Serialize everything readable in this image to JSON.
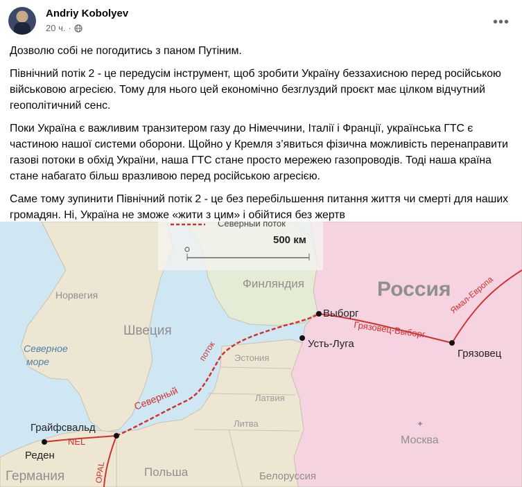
{
  "post": {
    "author": "Andriy Kobolyev",
    "time": "20 ч.",
    "separator": "·",
    "privacy_icon": "globe-icon",
    "more_icon": "more-dots-icon",
    "more_label": "•••",
    "paragraphs": [
      "Дозволю собі не погодитись з паном Путіним.",
      "Північний потік 2 - це передусім інструмент, щоб зробити Україну беззахисною перед російською військовою агресією. Тому для нього цей економічно безглуздий проєкт має цілком відчутний геополітичний сенс.",
      "Поки Україна є важливим транзитером газу до Німеччини, Італії і Франції, українська ГТС є частиною нашої системи оборони. Щойно у Кремля з’явиться фізична можливість перенаправити газові потоки в обхід України, наша ГТС стане просто мережею газопроводів. Тоді наша країна стане набагато більш вразливою перед російською агресією.",
      "Саме тому зупинити Північний потік 2 - це без перебільшення питання життя чи смерті для наших громадян. Ні, Україна не зможе «жити з цим» і обійтися без жертв"
    ]
  },
  "map": {
    "legend_title": "Северный поток",
    "scale_label": "500 км",
    "countries": {
      "russia": "Россия",
      "finland": "Финляндия",
      "norway": "Норвегия",
      "sweden": "Швеция",
      "estonia": "Эстония",
      "latvia": "Латвия",
      "lithuania": "Литва",
      "poland": "Польша",
      "germany": "Германия",
      "belarus": "Белоруссия"
    },
    "sea": {
      "north_sea_1": "Северное",
      "north_sea_2": "море"
    },
    "cities": {
      "vyborg": "Выборг",
      "ust_luga": "Усть-Луга",
      "gryazovets": "Грязовец",
      "greifswald": "Грайфсвальд",
      "reden": "Реден",
      "moscow": "Москва"
    },
    "pipelines": {
      "nord_stream_1": "Северный",
      "nord_stream_2": "поток",
      "gryazovets_vyborg": "Грязовец-Выборг",
      "yamal_europe": "Ямал-Европа",
      "nel": "NEL",
      "opal": "OPAL"
    },
    "colors": {
      "sea": "#cfe6f3",
      "land_west": "#ede6d3",
      "russia": "#f5d3e1",
      "finland": "#e4ecd5",
      "pipeline": "#d0312d",
      "label_grey": "#8f8f8f"
    }
  }
}
